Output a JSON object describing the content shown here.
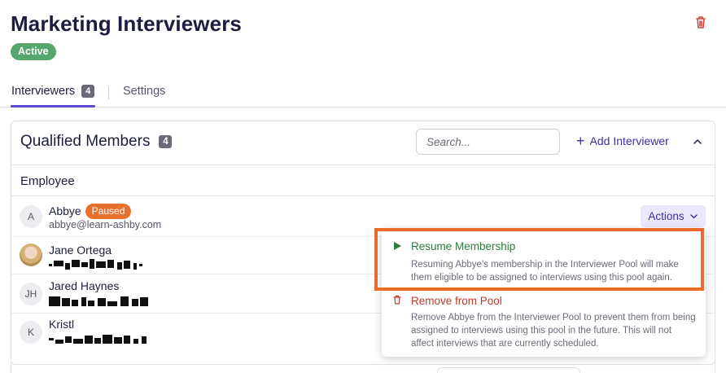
{
  "header": {
    "title": "Marketing Interviewers",
    "status": "Active",
    "status_color": "#56a66e",
    "delete_icon": "trash-icon"
  },
  "tabs": [
    {
      "label": "Interviewers",
      "count": "4",
      "active": true
    },
    {
      "label": "Settings",
      "active": false
    }
  ],
  "members": {
    "title": "Qualified Members",
    "count": "4",
    "search_placeholder": "Search...",
    "add_label": "Add Interviewer",
    "column_header": "Employee",
    "rows": [
      {
        "initial": "A",
        "name": "Abbye",
        "badge": "Paused",
        "email": "abbye@learn-ashby.com",
        "actions_label": "Actions"
      },
      {
        "initial": "",
        "name": "Jane Ortega"
      },
      {
        "initial": "JH",
        "name": "Jared Haynes"
      },
      {
        "initial": "K",
        "name": "Kristl"
      }
    ]
  },
  "actions_menu": {
    "items": [
      {
        "label": "Resume Membership",
        "icon": "play-icon",
        "description": "Resuming Abbye's membership in the Interviewer Pool will make them eligible to be assigned to interviews using this pool again."
      },
      {
        "label": "Remove from Pool",
        "icon": "trash-icon",
        "description": "Remove Abbye from the Interviewer Pool to prevent them from being assigned to interviews using this pool in the future. This will not affect interviews that are currently scheduled."
      }
    ]
  },
  "colors": {
    "accent": "#5b4bd6",
    "link": "#3d2fa8",
    "paused": "#e8702c",
    "highlight": "#ec6a2a",
    "resume": "#2f7d3c",
    "remove": "#c0392b"
  }
}
